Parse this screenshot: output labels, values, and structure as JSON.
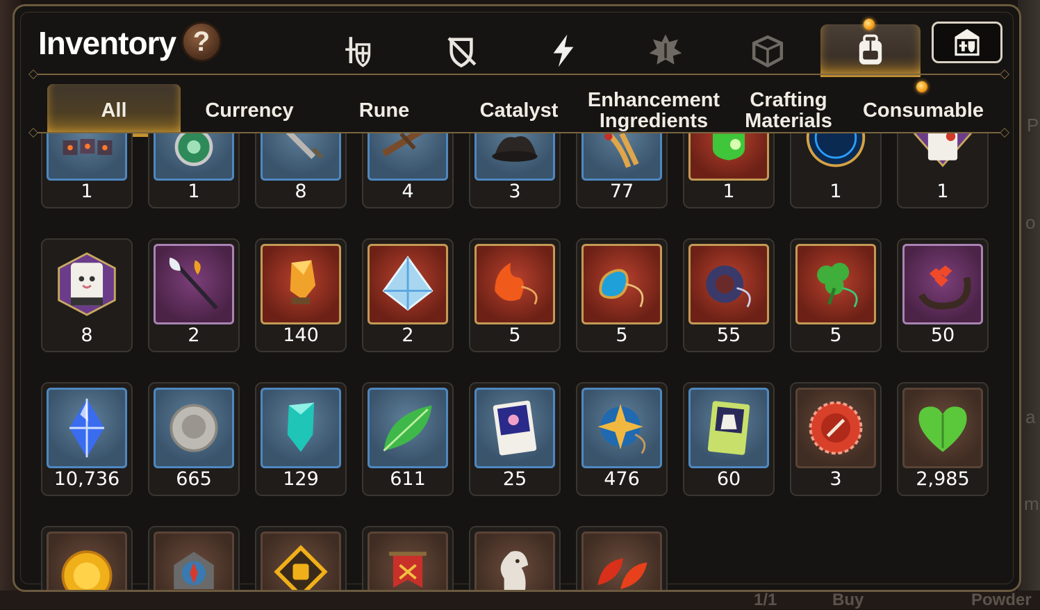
{
  "window": {
    "title": "Inventory",
    "help_label": "?"
  },
  "category_tabs": [
    {
      "icon": "weapon-armor-icon",
      "active": false
    },
    {
      "icon": "broken-shield-icon",
      "active": false
    },
    {
      "icon": "lightning-icon",
      "active": false
    },
    {
      "icon": "sealed-emblem-icon",
      "active": false
    },
    {
      "icon": "cube-icon",
      "active": false
    },
    {
      "icon": "backpack-icon",
      "active": true,
      "notification": true
    },
    {
      "icon": "castle-shield-icon",
      "active": false
    }
  ],
  "sub_tabs": [
    {
      "label": "All",
      "active": true
    },
    {
      "label": "Currency"
    },
    {
      "label": "Rune"
    },
    {
      "label": "Catalyst"
    },
    {
      "label": "Enhancement Ingredients"
    },
    {
      "label": "Crafting Materials"
    },
    {
      "label": "Consumable",
      "notification": true
    }
  ],
  "items": {
    "row1": [
      {
        "icon": "rune-stones-icon",
        "qty": "1",
        "frame": "blue"
      },
      {
        "icon": "green-brooch-icon",
        "qty": "1",
        "frame": "blue"
      },
      {
        "icon": "sword-icon",
        "qty": "8",
        "frame": "blue"
      },
      {
        "icon": "crossbow-icon",
        "qty": "4",
        "frame": "blue"
      },
      {
        "icon": "dark-ore-icon",
        "qty": "3",
        "frame": "blue"
      },
      {
        "icon": "golden-root-icon",
        "qty": "77",
        "frame": "blue"
      },
      {
        "icon": "green-gem-icon",
        "qty": "1",
        "frame": "red"
      },
      {
        "icon": "blue-circle-rune-icon",
        "qty": "1",
        "frame": "hex"
      },
      {
        "icon": "pet-food-icon",
        "qty": "1",
        "frame": "hex"
      }
    ],
    "row2": [
      {
        "icon": "pet-cat-food-icon",
        "qty": "8",
        "frame": "hex"
      },
      {
        "icon": "feather-staff-icon",
        "qty": "2",
        "frame": "purple"
      },
      {
        "icon": "amber-crystal-icon",
        "qty": "140",
        "frame": "red"
      },
      {
        "icon": "ice-tetrahedron-icon",
        "qty": "2",
        "frame": "red"
      },
      {
        "icon": "fire-pendant-icon",
        "qty": "5",
        "frame": "red"
      },
      {
        "icon": "water-pendant-icon",
        "qty": "5",
        "frame": "red"
      },
      {
        "icon": "moon-pendant-icon",
        "qty": "55",
        "frame": "red"
      },
      {
        "icon": "clover-pendant-icon",
        "qty": "5",
        "frame": "red"
      },
      {
        "icon": "red-flower-ring-icon",
        "qty": "50",
        "frame": "purple"
      }
    ],
    "row3": [
      {
        "icon": "blue-crystal-icon",
        "qty": "10,736",
        "frame": "blue"
      },
      {
        "icon": "silver-coin-icon",
        "qty": "665",
        "frame": "blue"
      },
      {
        "icon": "cyan-crystal-icon",
        "qty": "129",
        "frame": "blue"
      },
      {
        "icon": "green-leaf-icon",
        "qty": "611",
        "frame": "blue"
      },
      {
        "icon": "pet-card-icon",
        "qty": "25",
        "frame": "blue"
      },
      {
        "icon": "star-pendant-icon",
        "qty": "476",
        "frame": "blue"
      },
      {
        "icon": "outfit-card-icon",
        "qty": "60",
        "frame": "blue"
      },
      {
        "icon": "red-seal-icon",
        "qty": "3",
        "frame": "brown"
      },
      {
        "icon": "green-heart-icon",
        "qty": "2,985",
        "frame": "brown"
      }
    ],
    "row4": [
      {
        "icon": "sun-coin-icon",
        "frame": "brown"
      },
      {
        "icon": "compass-stone-icon",
        "frame": "brown"
      },
      {
        "icon": "fist-emblem-icon",
        "frame": "brown"
      },
      {
        "icon": "war-banner-icon",
        "frame": "brown"
      },
      {
        "icon": "knight-piece-icon",
        "frame": "brown"
      },
      {
        "icon": "red-leaves-icon",
        "frame": "brown"
      }
    ]
  },
  "background": {
    "right_letters": [
      "P",
      "o",
      "a",
      "m"
    ],
    "bottom_texts": [
      "1/1",
      "Buy",
      "Powder"
    ]
  },
  "colors": {
    "accent_gold": "#f2b23a",
    "frame_blue": "#4f88c0",
    "frame_red": "#c49a55",
    "notification": "#f39a12"
  }
}
